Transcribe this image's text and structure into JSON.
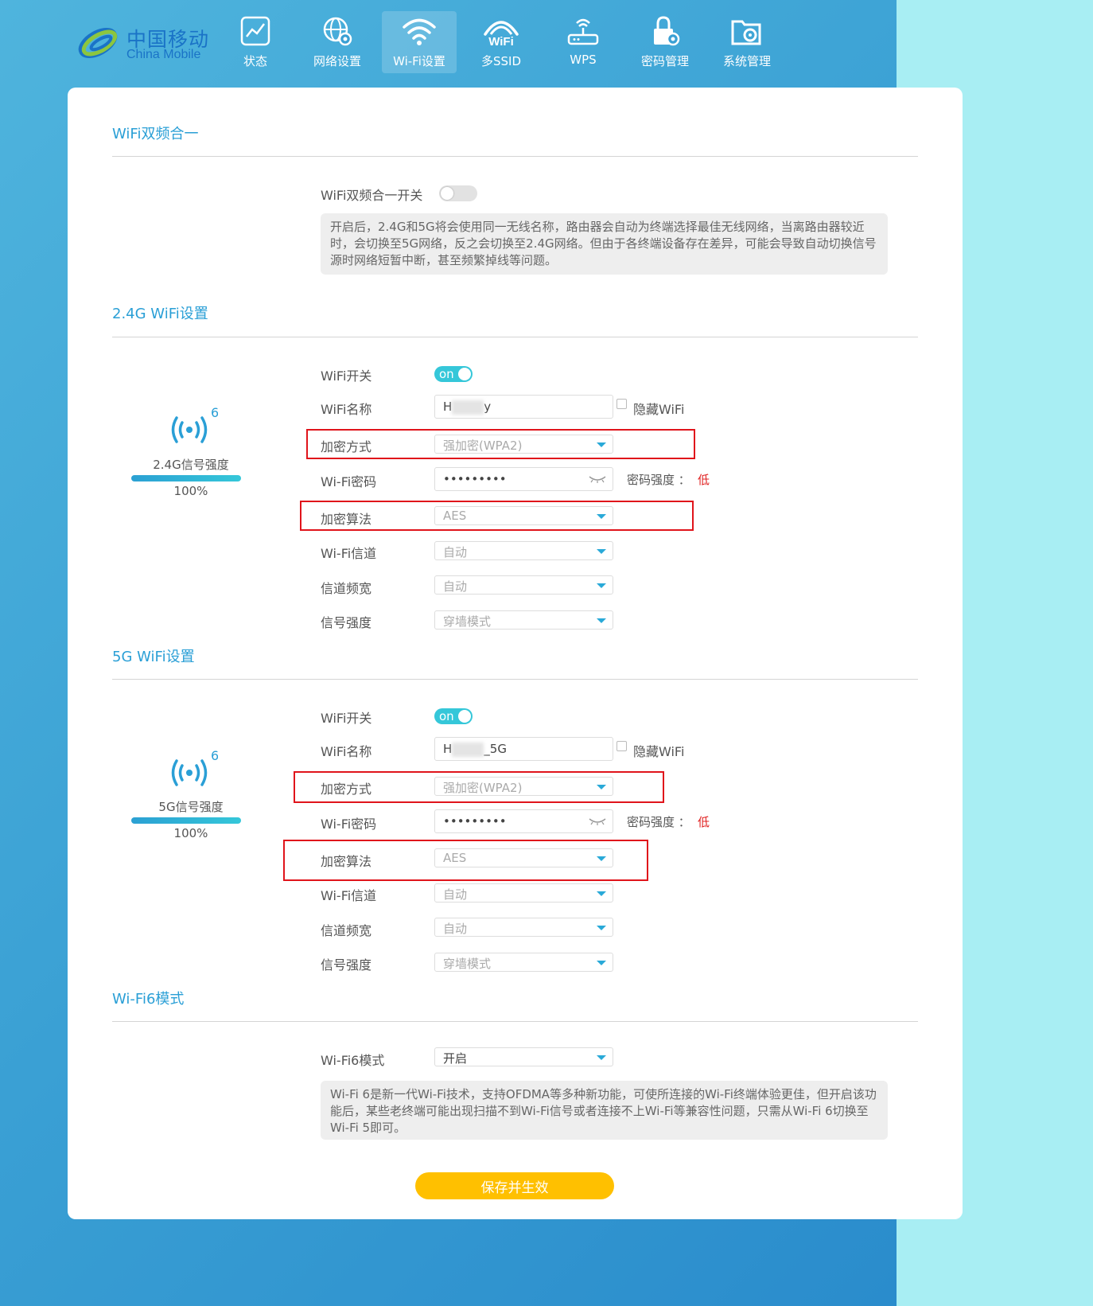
{
  "brand": {
    "name_cn": "中国移动",
    "name_en": "China Mobile"
  },
  "nav": [
    {
      "label": "状态",
      "icon": "chart-icon",
      "active": false
    },
    {
      "label": "网络设置",
      "icon": "globe-gear-icon",
      "active": false
    },
    {
      "label": "Wi-Fi设置",
      "icon": "wifi-icon",
      "active": true
    },
    {
      "label": "多SSID",
      "icon": "wifi-text-icon",
      "active": false
    },
    {
      "label": "WPS",
      "icon": "router-icon",
      "active": false
    },
    {
      "label": "密码管理",
      "icon": "lock-gear-icon",
      "active": false
    },
    {
      "label": "系统管理",
      "icon": "folder-gear-icon",
      "active": false
    }
  ],
  "dual_band": {
    "title": "WiFi双频合一",
    "switch_label": "WiFi双频合一开关",
    "switch_on": false,
    "note": "开启后，2.4G和5G将会使用同一无线名称，路由器会自动为终端选择最佳无线网络，当离路由器较近时，会切换至5G网络，反之会切换至2.4G网络。但由于各终端设备存在差异，可能会导致自动切换信号源时网络短暂中断，甚至频繁掉线等问题。"
  },
  "wifi24": {
    "title": "2.4G WiFi设置",
    "signal_label": "2.4G信号强度",
    "signal_percent": "100%",
    "signal_fraction": 1.0,
    "switch_label": "WiFi开关",
    "switch_text": "on",
    "name_label": "WiFi名称",
    "name_prefix": "H",
    "name_suffix": "y",
    "hide_label": "隐藏WiFi",
    "enc_label": "加密方式",
    "enc_value": "强加密(WPA2)",
    "pwd_label": "Wi-Fi密码",
    "pwd_value": "•••••••••",
    "strength_label": "密码强度 ：",
    "strength_value": "低",
    "algo_label": "加密算法",
    "algo_value": "AES",
    "channel_label": "Wi-Fi信道",
    "channel_value": "自动",
    "bandwidth_label": "信道频宽",
    "bandwidth_value": "自动",
    "power_label": "信号强度",
    "power_value": "穿墙模式"
  },
  "wifi5": {
    "title": "5G WiFi设置",
    "signal_label": "5G信号强度",
    "signal_percent": "100%",
    "signal_fraction": 1.0,
    "switch_label": "WiFi开关",
    "switch_text": "on",
    "name_label": "WiFi名称",
    "name_prefix": "H",
    "name_suffix": "_5G",
    "hide_label": "隐藏WiFi",
    "enc_label": "加密方式",
    "enc_value": "强加密(WPA2)",
    "pwd_label": "Wi-Fi密码",
    "pwd_value": "•••••••••",
    "strength_label": "密码强度 ：",
    "strength_value": "低",
    "algo_label": "加密算法",
    "algo_value": "AES",
    "channel_label": "Wi-Fi信道",
    "channel_value": "自动",
    "bandwidth_label": "信道频宽",
    "bandwidth_value": "自动",
    "power_label": "信号强度",
    "power_value": "穿墙模式"
  },
  "wifi6": {
    "title": "Wi-Fi6模式",
    "mode_label": "Wi-Fi6模式",
    "mode_value": "开启",
    "note": "Wi-Fi 6是新一代Wi-Fi技术，支持OFDMA等多种新功能，可使所连接的Wi-Fi终端体验更佳，但开启该功能后，某些老终端可能出现扫描不到Wi-Fi信号或者连接不上Wi-Fi等兼容性问题，只需从Wi-Fi 6切换至Wi-Fi 5即可。"
  },
  "save_label": "保存并生效",
  "signal_superscript": "6",
  "colors": {
    "accent": "#2a9fd6",
    "toggle": "#35c7d9",
    "button": "#ffc000",
    "highlight": "#e0141b",
    "weak": "#e02020"
  }
}
